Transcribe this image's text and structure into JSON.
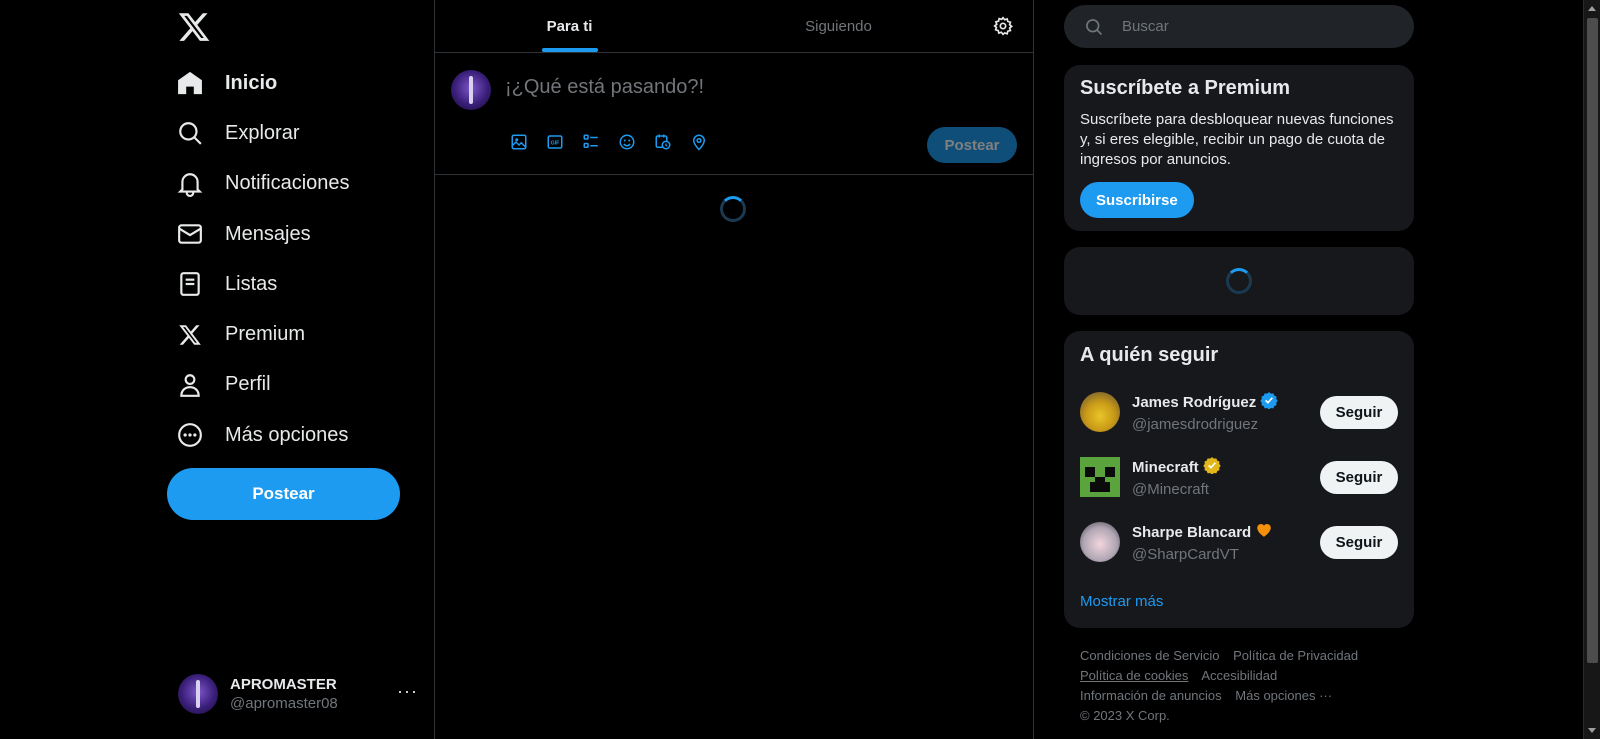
{
  "colors": {
    "accent": "#1d9bf0",
    "background": "#000000",
    "card": "#16181c",
    "muted": "#71767b",
    "text": "#e7e9ea"
  },
  "sidebar": {
    "logo_icon": "x-logo-icon",
    "items": [
      {
        "label": "Inicio",
        "icon": "home-icon"
      },
      {
        "label": "Explorar",
        "icon": "search-icon"
      },
      {
        "label": "Notificaciones",
        "icon": "bell-icon"
      },
      {
        "label": "Mensajes",
        "icon": "mail-icon"
      },
      {
        "label": "Listas",
        "icon": "list-icon"
      },
      {
        "label": "Premium",
        "icon": "x-logo-icon"
      },
      {
        "label": "Perfil",
        "icon": "person-icon"
      },
      {
        "label": "Más opciones",
        "icon": "more-circle-icon"
      }
    ],
    "post_label": "Postear",
    "account": {
      "name": "APROMASTER",
      "handle": "@apromaster08",
      "more": "···"
    }
  },
  "timeline": {
    "tabs": [
      {
        "label": "Para ti"
      },
      {
        "label": "Siguiendo"
      }
    ],
    "settings_icon": "gear-icon",
    "composer": {
      "placeholder": "¡¿Qué está pasando?!",
      "tools": [
        "image-icon",
        "gif-icon",
        "poll-icon",
        "emoji-icon",
        "schedule-icon",
        "location-icon"
      ],
      "post_label": "Postear"
    }
  },
  "right": {
    "search_placeholder": "Buscar",
    "premium": {
      "title": "Suscríbete a Premium",
      "description": "Suscríbete para desbloquear nuevas funciones y, si eres elegible, recibir un pago de cuota de ingresos por anuncios.",
      "button": "Suscribirse"
    },
    "who_to_follow": {
      "title": "A quién seguir",
      "users": [
        {
          "name": "James Rodríguez",
          "handle": "@jamesdrodriguez",
          "badge": "verified-blue-icon",
          "button": "Seguir"
        },
        {
          "name": "Minecraft",
          "handle": "@Minecraft",
          "badge": "verified-gold-icon",
          "button": "Seguir"
        },
        {
          "name": "Sharpe Blancard",
          "handle": "@SharpCardVT",
          "badge": "orange-heart-icon",
          "button": "Seguir"
        }
      ],
      "show_more": "Mostrar más"
    },
    "footer": {
      "links": [
        "Condiciones de Servicio",
        "Política de Privacidad",
        "Política de cookies",
        "Accesibilidad",
        "Información de anuncios",
        "Más opciones ···"
      ],
      "copyright": "© 2023 X Corp."
    }
  }
}
